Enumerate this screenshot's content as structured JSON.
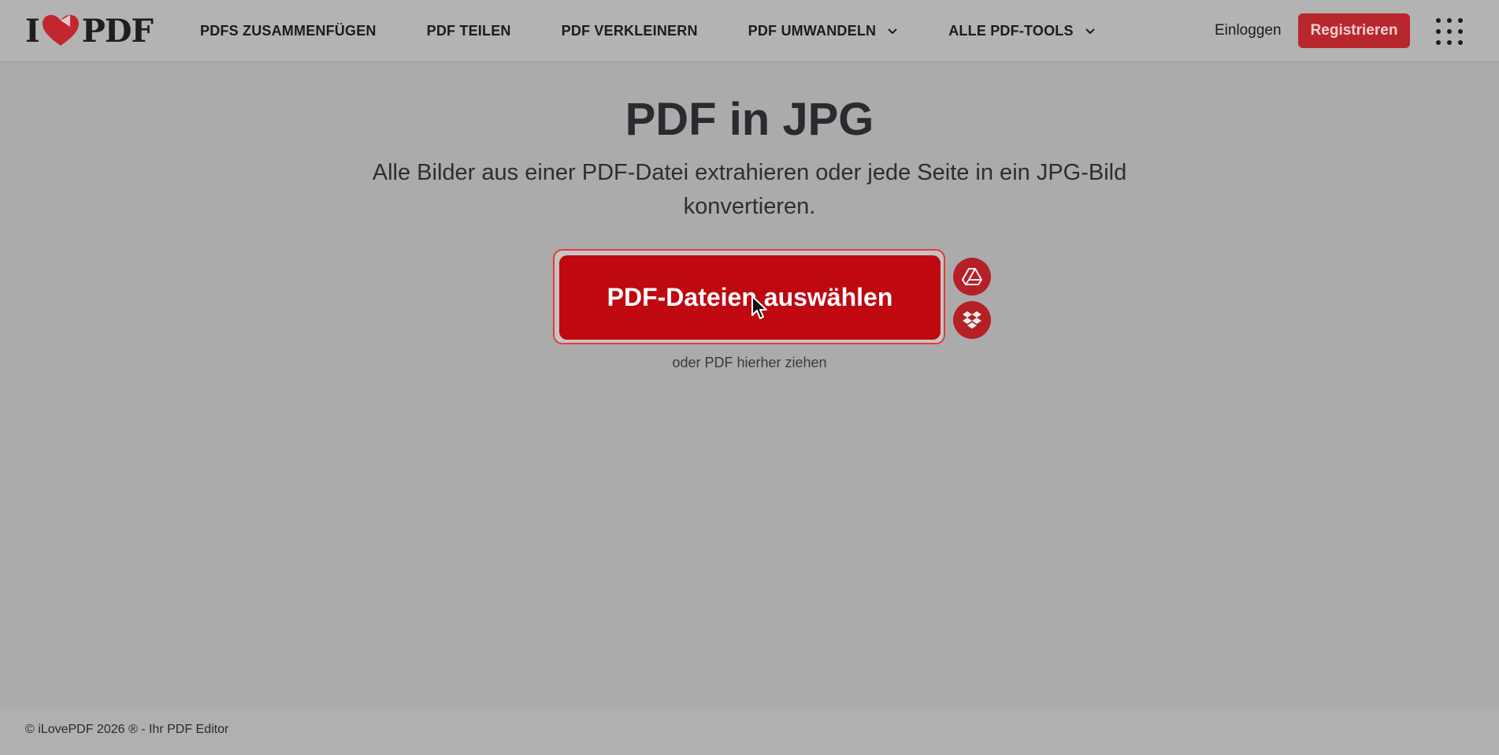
{
  "header": {
    "logo": {
      "left_text": "I",
      "right_text": "PDF",
      "accent": "#e5322d"
    },
    "nav": [
      {
        "label": "PDFS ZUSAMMENFÜGEN",
        "dropdown": false
      },
      {
        "label": "PDF TEILEN",
        "dropdown": false
      },
      {
        "label": "PDF VERKLEINERN",
        "dropdown": false
      },
      {
        "label": "PDF UMWANDELN",
        "dropdown": true
      },
      {
        "label": "ALLE PDF-TOOLS",
        "dropdown": true
      }
    ],
    "login_label": "Einloggen",
    "register_label": "Registrieren",
    "apps_icon": "grid-apps-icon"
  },
  "main": {
    "title": "PDF in JPG",
    "subtitle": "Alle Bilder aus einer PDF-Datei extrahieren oder jede Seite in ein JPG-Bild konvertieren.",
    "upload_label": "PDF-Dateien auswählen",
    "drag_hint": "oder PDF hierher ziehen",
    "cloud_sources": [
      "google-drive-icon",
      "dropbox-icon"
    ]
  },
  "footer": {
    "copyright": "© iLovePDF 2026 ® - Ihr PDF Editor"
  },
  "colors": {
    "primary": "#bf080f",
    "register_bg": "#b8272c",
    "overlay_bg": "#ababab"
  }
}
